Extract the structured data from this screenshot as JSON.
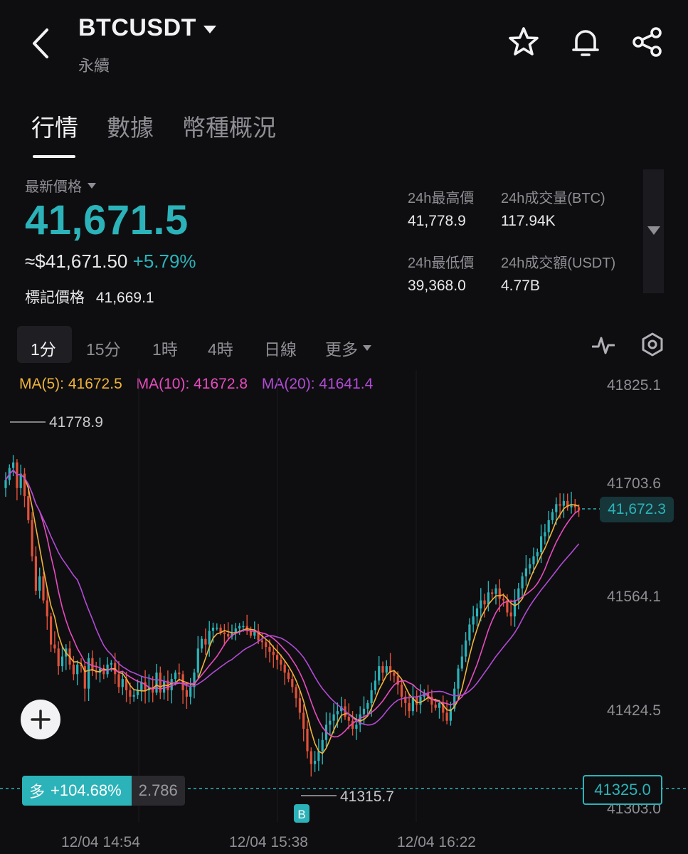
{
  "header": {
    "symbol": "BTCUSDT",
    "subtitle": "永續"
  },
  "tabs": [
    {
      "label": "行情"
    },
    {
      "label": "數據"
    },
    {
      "label": "幣種概況"
    }
  ],
  "price": {
    "label": "最新價格",
    "last": "41,671.5",
    "usd": "≈$41,671.50",
    "change": "+5.79%",
    "mark_label": "標記價格",
    "mark_value": "41,669.1"
  },
  "stats": {
    "high_label": "24h最高價",
    "high_value": "41,778.9",
    "vol_btc_label": "24h成交量(BTC)",
    "vol_btc_value": "117.94K",
    "low_label": "24h最低價",
    "low_value": "39,368.0",
    "vol_usdt_label": "24h成交額(USDT)",
    "vol_usdt_value": "4.77B"
  },
  "intervals": [
    {
      "label": "1分"
    },
    {
      "label": "15分"
    },
    {
      "label": "1時"
    },
    {
      "label": "4時"
    },
    {
      "label": "日線"
    },
    {
      "label": "更多"
    }
  ],
  "ma": {
    "ma5": "MA(5): 41672.5",
    "ma10": "MA(10): 41672.8",
    "ma20": "MA(20): 41641.4"
  },
  "position": {
    "side": "多",
    "pnl": "+104.68%",
    "qty": "2.786",
    "marker": "B"
  },
  "colors": {
    "up": "#2bb3b9",
    "down": "#e0523a",
    "ma5": "#f0b33a",
    "ma10": "#e84bbf",
    "ma20": "#b24bd6"
  },
  "chart_data": {
    "type": "candlestick",
    "y_ticks": [
      "41825.1",
      "41703.6",
      "41564.1",
      "41424.5",
      "41303.0"
    ],
    "x_ticks": [
      "12/04 14:54",
      "12/04 15:38",
      "12/04 16:22"
    ],
    "ylim": [
      41290,
      41840
    ],
    "last_price_tag": "41,672.3",
    "crosshair_price": "41325.0",
    "high_marker": "41778.9",
    "low_marker": "41315.7",
    "close": [
      41710,
      41725,
      41732,
      41700,
      41718,
      41690,
      41660,
      41615,
      41572,
      41590,
      41560,
      41540,
      41505,
      41500,
      41478,
      41490,
      41500,
      41480,
      41468,
      41480,
      41478,
      41450,
      41488,
      41472,
      41470,
      41475,
      41468,
      41480,
      41482,
      41468,
      41452,
      41462,
      41448,
      41440,
      41442,
      41448,
      41458,
      41448,
      41452,
      41445,
      41470,
      41445,
      41460,
      41448,
      41462,
      41470,
      41468,
      41448,
      41440,
      41452,
      41470,
      41500,
      41512,
      41505,
      41522,
      41526,
      41526,
      41520,
      41518,
      41515,
      41520,
      41525,
      41528,
      41528,
      41522,
      41516,
      41522,
      41510,
      41508,
      41502,
      41496,
      41492,
      41486,
      41480,
      41470,
      41462,
      41452,
      41438,
      41420,
      41400,
      41372,
      41356,
      41360,
      41372,
      41386,
      41405,
      41410,
      41418,
      41422,
      41428,
      41415,
      41410,
      41400,
      41405,
      41418,
      41425,
      41432,
      41448,
      41460,
      41478,
      41470,
      41478,
      41470,
      41466,
      41455,
      41440,
      41432,
      41422,
      41440,
      41430,
      41440,
      41445,
      41440,
      41430,
      41426,
      41432,
      41420,
      41410,
      41425,
      41450,
      41475,
      41490,
      41510,
      41530,
      41540,
      41550,
      41560,
      41555,
      41570,
      41568,
      41575,
      41562,
      41560,
      41545,
      41540,
      41560,
      41575,
      41590,
      41600,
      41605,
      41615,
      41620,
      41640,
      41645,
      41660,
      41670,
      41680,
      41678,
      41684,
      41676,
      41680,
      41676,
      41672
    ]
  }
}
